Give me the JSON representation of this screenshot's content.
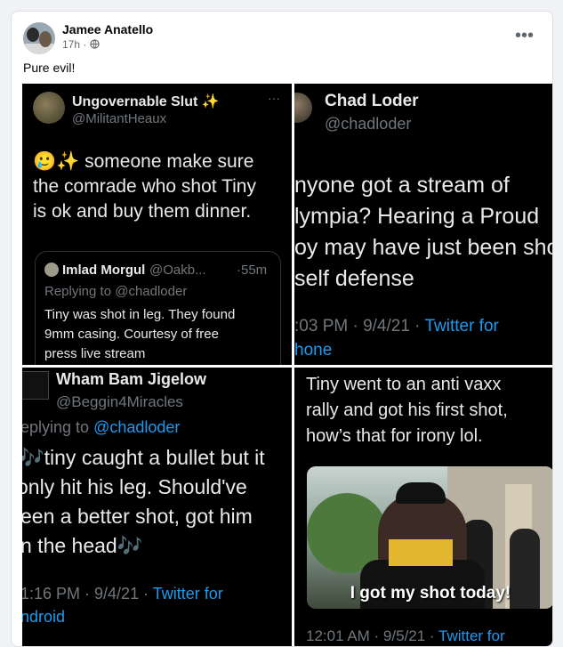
{
  "post": {
    "author": "Jamee Anatello",
    "time": "17h",
    "separator": "·",
    "privacy_icon": "globe-icon",
    "more_label": "•••",
    "caption": "Pure evil!"
  },
  "tweets": {
    "t1": {
      "name": "Ungovernable Slut ✨",
      "handle": "@MilitantHeaux",
      "more": "···",
      "lines": [
        "🥲✨ someone make sure",
        "the comrade who shot Tiny",
        "is ok and buy them dinner."
      ],
      "quote": {
        "name": "Imlad Morgul",
        "handle": "@Oakb...",
        "time": "·55m",
        "reply_prefix": "Replying to",
        "reply_to": "@chadloder",
        "lines": [
          "Tiny was shot in leg. They found",
          "9mm casing. Courtesy of free",
          "press live stream"
        ]
      }
    },
    "t2": {
      "name": "Chad Loder",
      "handle": "@chadloder",
      "lines": [
        "nyone got a stream of",
        "lympia? Hearing a Proud",
        "oy may have just been sho",
        "self defense"
      ],
      "footer_time": ":03 PM · 9/4/21 ·",
      "footer_link": "Twitter for",
      "footer_link2": "hone"
    },
    "t3": {
      "name": "Wham Bam Jigelow",
      "handle": "@Beggin4Miracles",
      "reply_prefix": "eplying to",
      "reply_to": "@chadloder",
      "lines": [
        "🎶tiny caught a bullet but it",
        "only hit his leg. Should've",
        "een a better shot, got him",
        "n the head🎶"
      ],
      "footer_time": "1:16 PM · 9/4/21 ·",
      "footer_link": "Twitter for",
      "footer_link2": "ndroid"
    },
    "t4": {
      "lines": [
        "Tiny went to an anti vaxx",
        "rally and got his first shot,",
        "how’s that for irony lol."
      ],
      "subtitle": "I got my shot today!",
      "footer_time": "12:01 AM · 9/5/21 ·",
      "footer_link": "Twitter for"
    }
  }
}
